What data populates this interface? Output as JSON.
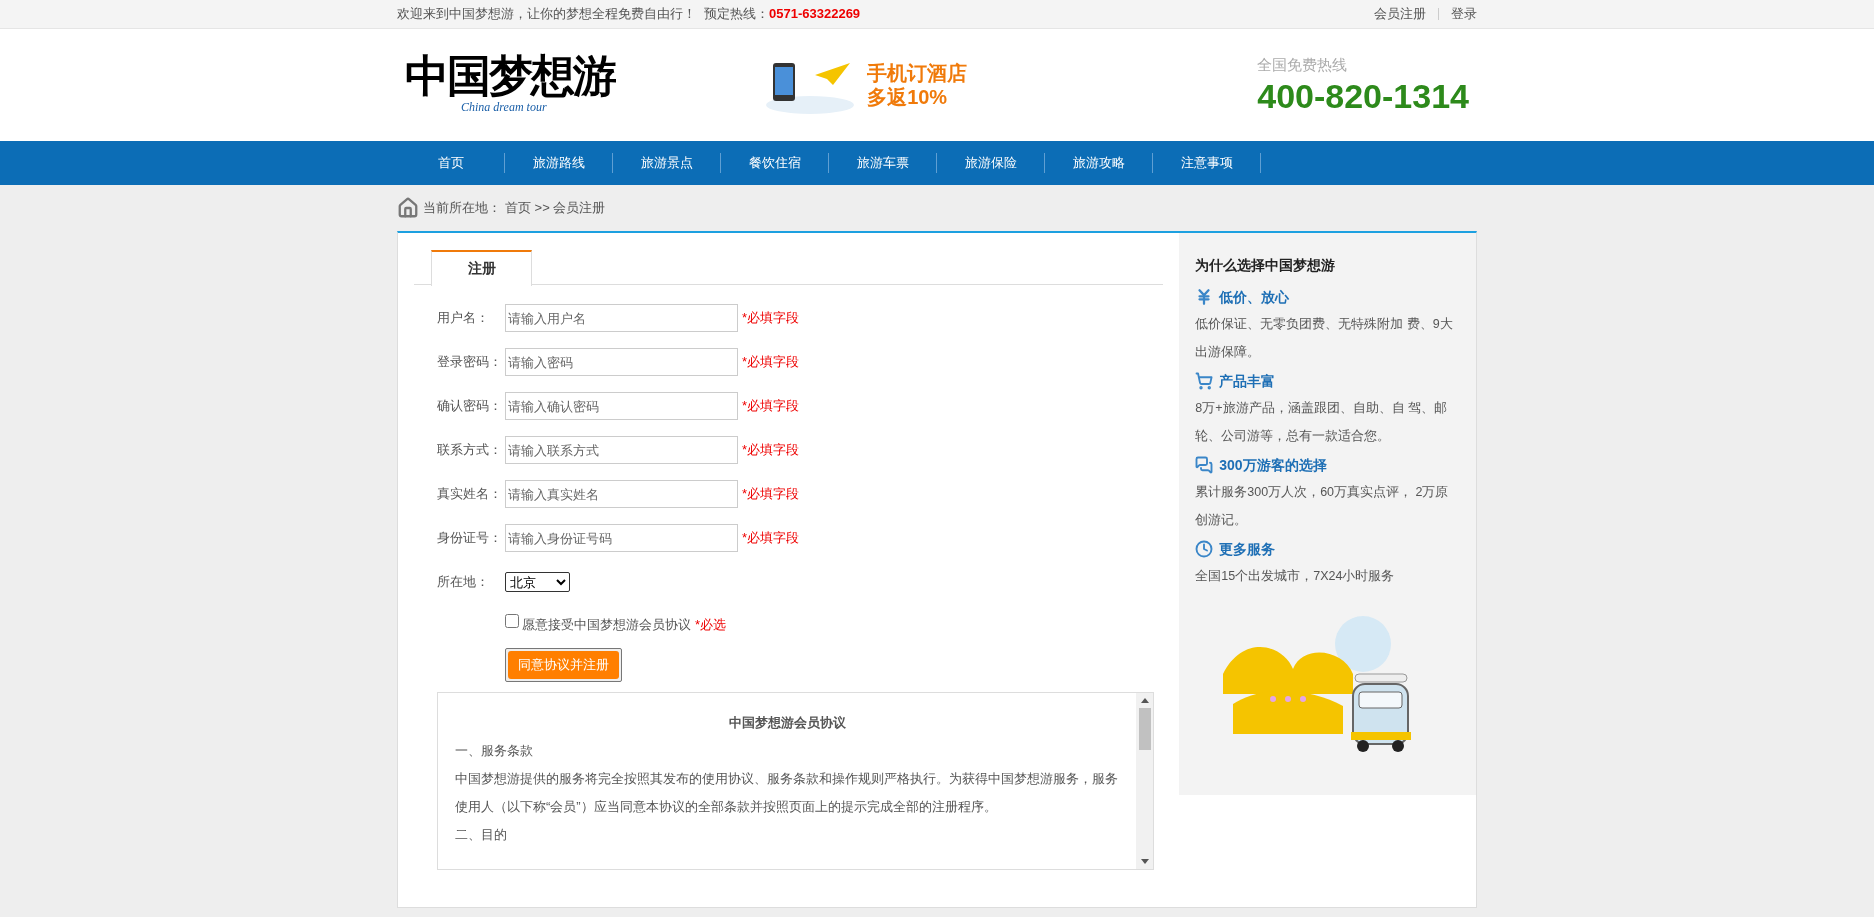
{
  "top_bar": {
    "welcome": "欢迎来到中国梦想游，让你的梦想全程免费自由行！",
    "hotline_label": "预定热线：",
    "hotline_number": "0571-63322269",
    "links": [
      "会员注册",
      "登录"
    ]
  },
  "header": {
    "logo": {
      "title": "中国梦想游",
      "subtitle": "China dream tour"
    },
    "promo": {
      "line1": "手机订酒店",
      "line2": "多返10%"
    },
    "hotline": {
      "label": "全国免费热线",
      "number": "400-820-1314"
    }
  },
  "nav": [
    "首页",
    "旅游路线",
    "旅游景点",
    "餐饮住宿",
    "旅游车票",
    "旅游保险",
    "旅游攻略",
    "注意事项"
  ],
  "breadcrumb": {
    "label": "当前所在地：",
    "path": "首页 >> 会员注册"
  },
  "tabs": [
    {
      "label": "注册",
      "selected": true
    }
  ],
  "form": {
    "fields": [
      {
        "label": "用户名：",
        "placeholder": "请输入用户名",
        "note": "*必填字段"
      },
      {
        "label": "登录密码：",
        "placeholder": "请输入密码",
        "note": "*必填字段"
      },
      {
        "label": "确认密码：",
        "placeholder": "请输入确认密码",
        "note": "*必填字段"
      },
      {
        "label": "联系方式：",
        "placeholder": "请输入联系方式",
        "note": "*必填字段"
      },
      {
        "label": "真实姓名：",
        "placeholder": "请输入真实姓名",
        "note": "*必填字段"
      },
      {
        "label": "身份证号：",
        "placeholder": "请输入身份证号码",
        "note": "*必填字段"
      }
    ],
    "location": {
      "label": "所在地：",
      "value": "北京"
    },
    "agree": {
      "checked": false,
      "text": "愿意接受中国梦想游会员协议",
      "note": "*必选"
    },
    "submit": "同意协议并注册"
  },
  "agreement": {
    "title": "中国梦想游会员协议",
    "paragraphs": [
      "一、服务条款",
      "中国梦想游提供的服务将完全按照其发布的使用协议、服务条款和操作规则严格执行。为获得中国梦想游服务，服务使用人（以下称“会员”）应当同意本协议的全部条款并按照页面上的提示完成全部的注册程序。",
      "二、目的"
    ]
  },
  "sidebar": {
    "title": "为什么选择中国梦想游",
    "items": [
      {
        "kind": "price",
        "heading": "低价、放心",
        "text": "低价保证、无零负团费、无特殊附加 费、9大出游保障。"
      },
      {
        "kind": "cart",
        "heading": "产品丰富",
        "text": "8万+旅游产品，涵盖跟团、自助、自 驾、邮轮、公司游等，总有一款适合您。"
      },
      {
        "kind": "chat",
        "heading": "300万游客的选择",
        "text": "累计服务300万人次，60万真实点评， 2万原创游记。"
      },
      {
        "kind": "service",
        "heading": "更多服务",
        "text": "全国15个出发城市，7X24小时服务"
      }
    ]
  }
}
